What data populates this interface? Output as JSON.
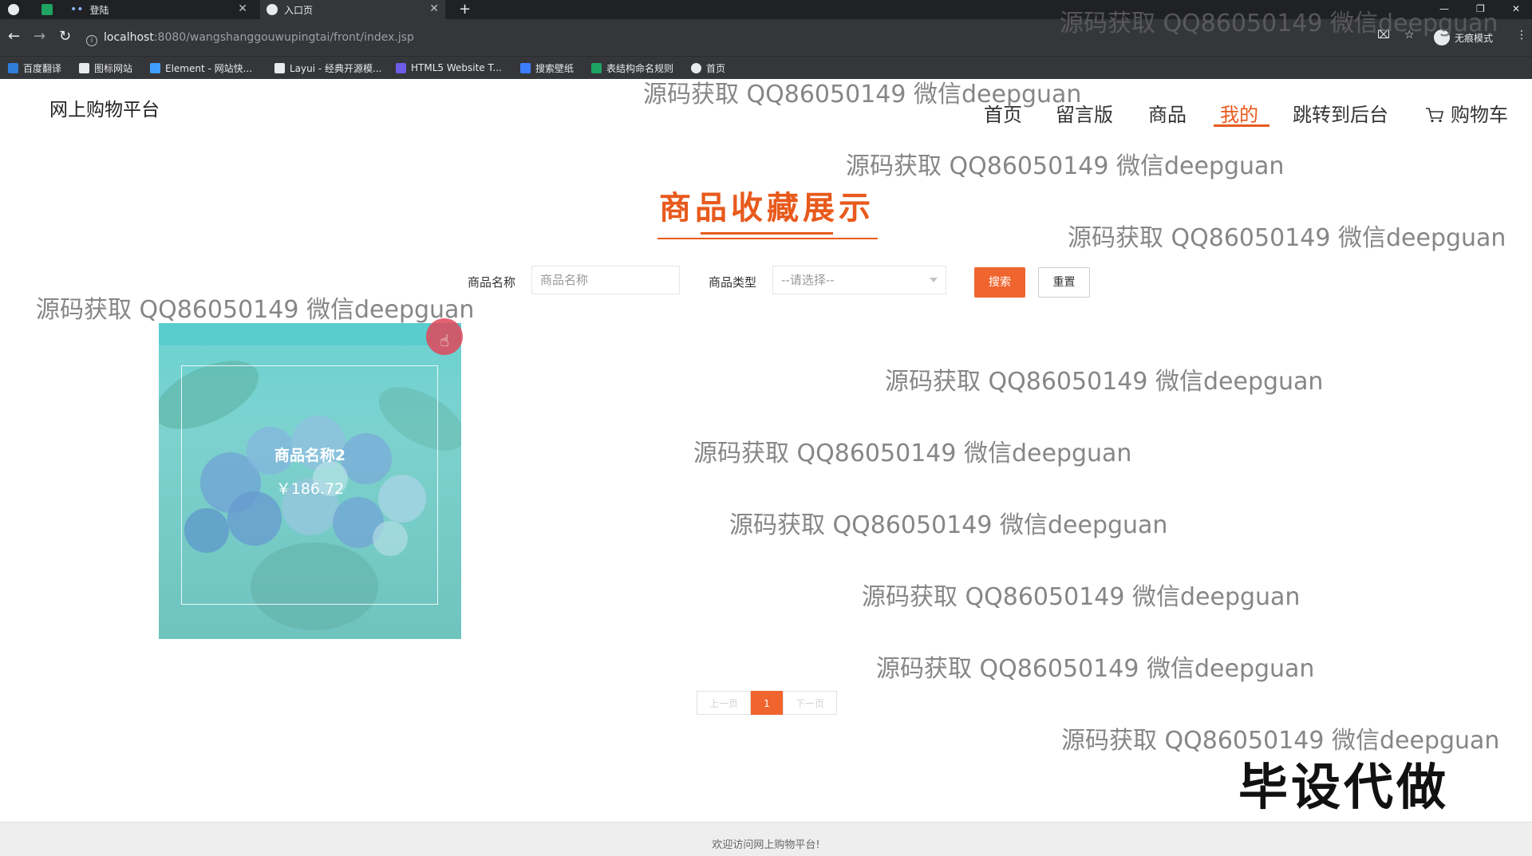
{
  "browser": {
    "tabs": [
      {
        "title": "",
        "icon": "browser-icon"
      },
      {
        "title": "",
        "icon": "green-app-icon"
      },
      {
        "title": "登陆",
        "icon": "dots-icon"
      },
      {
        "title": "入口页",
        "icon": "globe-icon"
      }
    ],
    "url_host": "localhost",
    "url_path": ":8080/wangshanggouwupingtai/front/index.jsp",
    "incognito_label": "无痕模式",
    "bookmarks": [
      {
        "label": "百度翻译",
        "color": "#2f7ed8"
      },
      {
        "label": "图标网站",
        "color": "#e8eaed"
      },
      {
        "label": "Element - 网站快...",
        "color": "#409eff"
      },
      {
        "label": "Layui - 经典开源模...",
        "color": "#e8eaed"
      },
      {
        "label": "HTML5 Website T...",
        "color": "#6c5ce7"
      },
      {
        "label": "搜索壁纸",
        "color": "#3d7eff"
      },
      {
        "label": "表结构命名规则",
        "color": "#1ea362"
      },
      {
        "label": "首页",
        "color": "#e8eaed"
      }
    ]
  },
  "header": {
    "logo": "网上购物平台",
    "nav": [
      "首页",
      "留言版",
      "商品",
      "我的",
      "跳转到后台"
    ],
    "cart": "购物车",
    "active_nav": "我的"
  },
  "section": {
    "title": "商品收藏展示"
  },
  "search": {
    "name_label": "商品名称",
    "name_placeholder": "商品名称",
    "type_label": "商品类型",
    "type_selected": "--请选择--",
    "search_button": "搜索",
    "reset_button": "重置"
  },
  "products": [
    {
      "name": "商品名称2",
      "price": "￥186.72"
    }
  ],
  "pagination": {
    "prev": "上一页",
    "current": "1",
    "next": "下一页"
  },
  "footer": {
    "text": "欢迎访问网上购物平台!"
  },
  "watermark": {
    "text": "源码获取 QQ86050149 微信deepguan",
    "stamp": "毕设代做"
  },
  "colors": {
    "accent": "#e85a1c",
    "button": "#f0642d"
  }
}
